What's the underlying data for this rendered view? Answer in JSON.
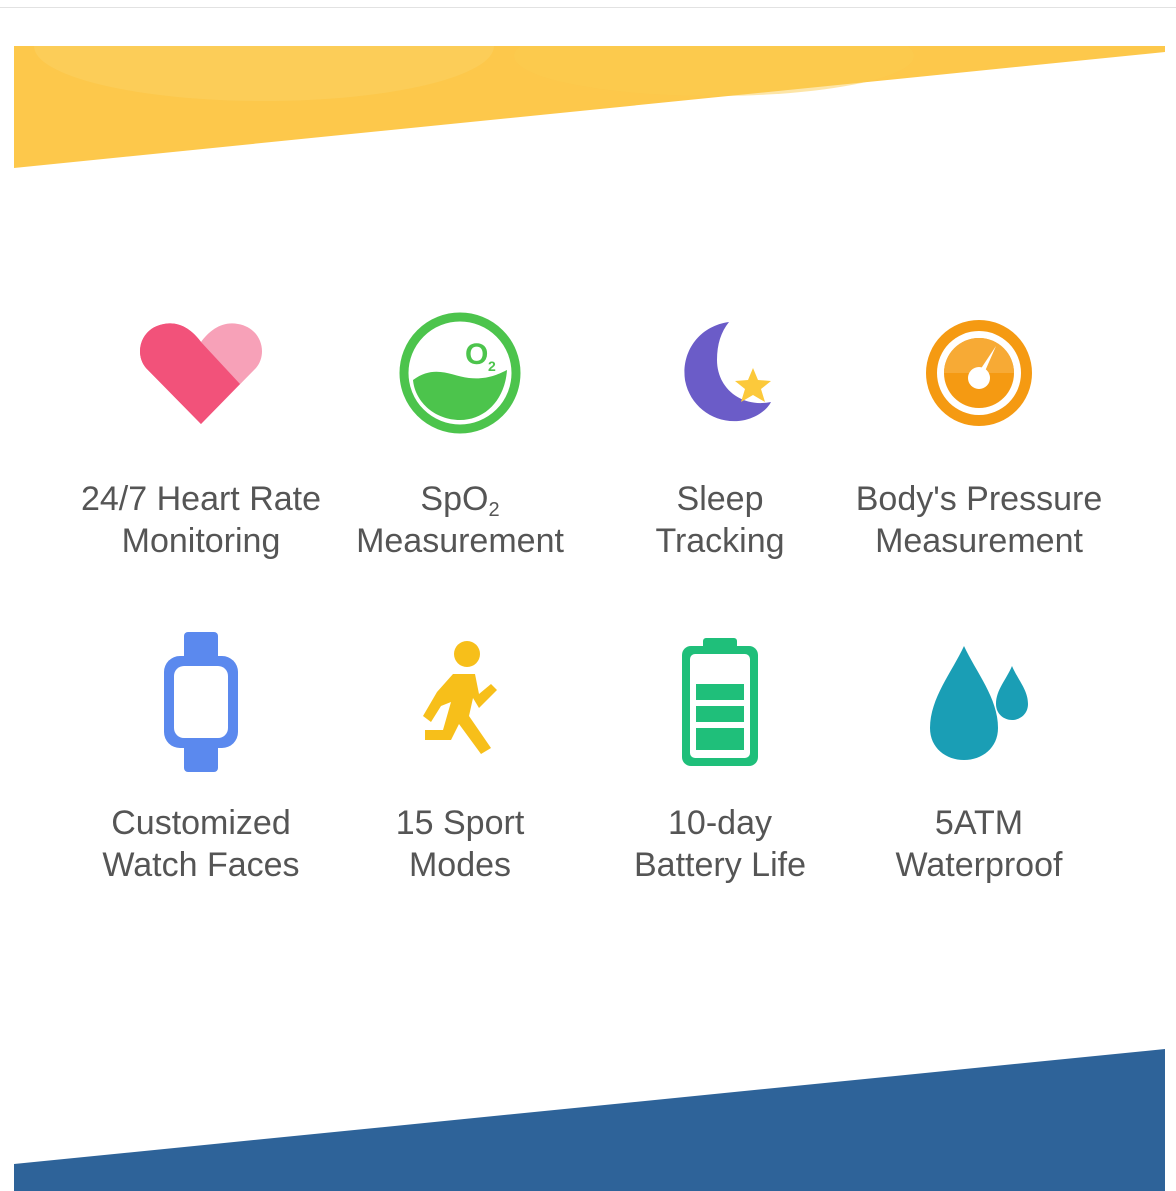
{
  "colors": {
    "banner_top": "#fdc84b",
    "banner_bottom": "#2e6399",
    "text": "#555555",
    "heart": "#f2527a",
    "heart_light": "#f7a1b8",
    "spo2": "#4cc44c",
    "moon": "#6b5cc8",
    "star": "#fcc93b",
    "pressure": "#f59a12",
    "watch": "#5b89ee",
    "runner": "#f7bf1a",
    "battery": "#1fbf7a",
    "water": "#1a9eb5"
  },
  "features": [
    {
      "icon": "heart-icon",
      "line1": "24/7 Heart Rate",
      "line2": "Monitoring"
    },
    {
      "icon": "oxygen-icon",
      "line1_prefix": "SpO",
      "line1_sub": "2",
      "line2": "Measurement",
      "icon_text": "O",
      "icon_sub": "2"
    },
    {
      "icon": "moon-icon",
      "line1": "Sleep",
      "line2": "Tracking"
    },
    {
      "icon": "gauge-icon",
      "line1": "Body's Pressure",
      "line2": "Measurement"
    },
    {
      "icon": "watch-icon",
      "line1": "Customized",
      "line2": "Watch Faces"
    },
    {
      "icon": "runner-icon",
      "line1": "15 Sport",
      "line2": "Modes"
    },
    {
      "icon": "battery-icon",
      "line1": "10-day",
      "line2": "Battery Life"
    },
    {
      "icon": "water-drop-icon",
      "line1": "5ATM",
      "line2": "Waterproof"
    }
  ]
}
